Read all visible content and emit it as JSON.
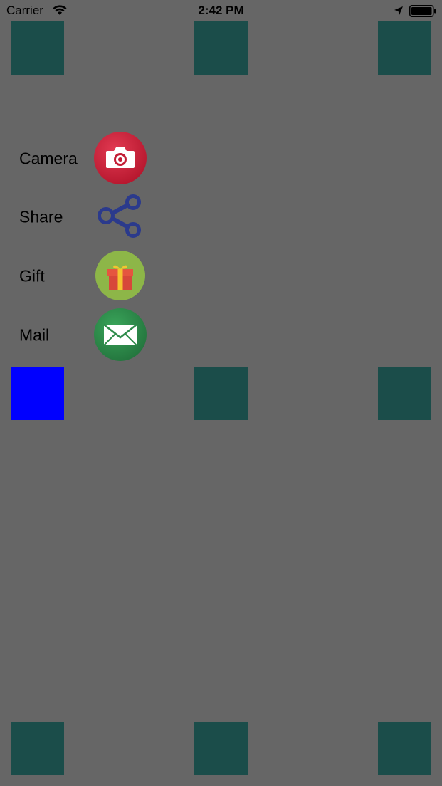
{
  "status_bar": {
    "carrier": "Carrier",
    "time": "2:42 PM",
    "icons": [
      "wifi-icon",
      "location-arrow-icon",
      "battery-icon"
    ]
  },
  "menu": {
    "items": [
      {
        "label": "Camera",
        "icon": "camera-icon"
      },
      {
        "label": "Share",
        "icon": "share-icon"
      },
      {
        "label": "Gift",
        "icon": "gift-icon"
      },
      {
        "label": "Mail",
        "icon": "mail-icon"
      }
    ]
  },
  "colors": {
    "background": "#666666",
    "square": "#1b4d4a",
    "selected_square": "#0000ff",
    "camera": "#c8203a",
    "share": "#2b3a8c",
    "gift": "#8db648",
    "mail": "#2e8b4a"
  }
}
